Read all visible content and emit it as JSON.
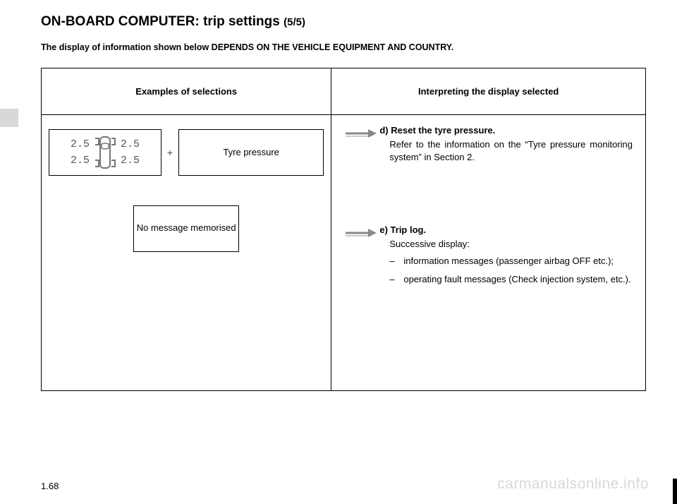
{
  "title_main": "ON-BOARD COMPUTER: trip settings",
  "title_part": "(5/5)",
  "subtitle": "The display of information shown below DEPENDS ON THE VEHICLE EQUIPMENT AND COUNTRY.",
  "table": {
    "header_left": "Examples of selections",
    "header_right": "Interpreting the display selected"
  },
  "tyre": {
    "fl": "2.5",
    "fr": "2.5",
    "rl": "2.5",
    "rr": "2.5",
    "plus": "+",
    "label": "Tyre pressure"
  },
  "msg_box": "No message memorised",
  "right": {
    "d_head": "d) Reset the tyre pressure.",
    "d_body": "Refer to the information on the “Tyre pressure monitor­ing system” in Section 2.",
    "e_head": "e) Trip log.",
    "e_sub": "Successive display:",
    "e_li1": "information messages (passenger airbag OFF etc.);",
    "e_li2": "operating fault messages (Check injection system, etc.)."
  },
  "page_number": "1.68",
  "watermark": "carmanualsonline.info"
}
